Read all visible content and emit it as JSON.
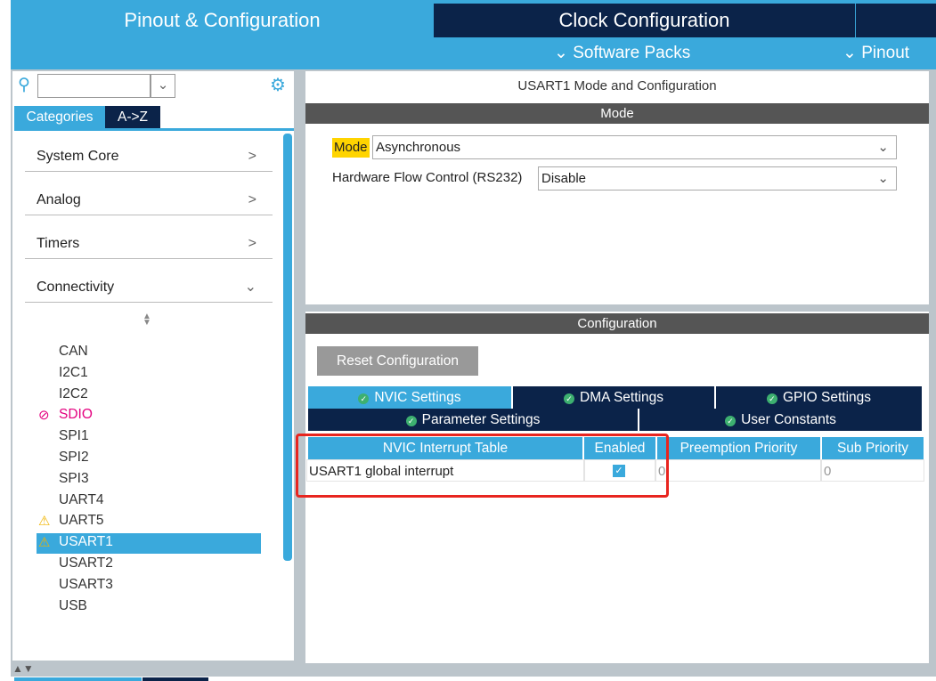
{
  "top_tabs": [
    "Pinout & Configuration",
    "Clock Configuration"
  ],
  "sub_menu": [
    "Software Packs",
    "Pinout"
  ],
  "search": {
    "value": "",
    "placeholder": ""
  },
  "left_tabs": [
    "Categories",
    "A->Z"
  ],
  "categories": [
    "System Core",
    "Analog",
    "Timers",
    "Connectivity"
  ],
  "connectivity_items": [
    {
      "label": "CAN",
      "status": ""
    },
    {
      "label": "I2C1",
      "status": ""
    },
    {
      "label": "I2C2",
      "status": ""
    },
    {
      "label": "SDIO",
      "status": "disabled"
    },
    {
      "label": "SPI1",
      "status": ""
    },
    {
      "label": "SPI2",
      "status": ""
    },
    {
      "label": "SPI3",
      "status": ""
    },
    {
      "label": "UART4",
      "status": ""
    },
    {
      "label": "UART5",
      "status": "warning"
    },
    {
      "label": "USART1",
      "status": "warning-selected"
    },
    {
      "label": "USART2",
      "status": ""
    },
    {
      "label": "USART3",
      "status": ""
    },
    {
      "label": "USB",
      "status": ""
    }
  ],
  "panel_title": "USART1 Mode and Configuration",
  "mode_header": "Mode",
  "mode": {
    "label": "Mode",
    "value": "Asynchronous"
  },
  "hw_flow": {
    "label": "Hardware Flow Control (RS232)",
    "value": "Disable"
  },
  "config_header": "Configuration",
  "reset_button": "Reset Configuration",
  "config_tabs": [
    "NVIC Settings",
    "DMA Settings",
    "GPIO Settings",
    "Parameter Settings",
    "User Constants"
  ],
  "table": {
    "headers": [
      "NVIC Interrupt Table",
      "Enabled",
      "Preemption Priority",
      "Sub Priority"
    ],
    "rows": [
      {
        "name": "USART1 global interrupt",
        "enabled": true,
        "preemption": "0",
        "sub": "0"
      }
    ]
  },
  "colors": {
    "accent": "#3aa9dc",
    "dark": "#0b2349",
    "highlight": "#ffd400",
    "error": "#e4007f",
    "annotation": "#e8251f"
  }
}
